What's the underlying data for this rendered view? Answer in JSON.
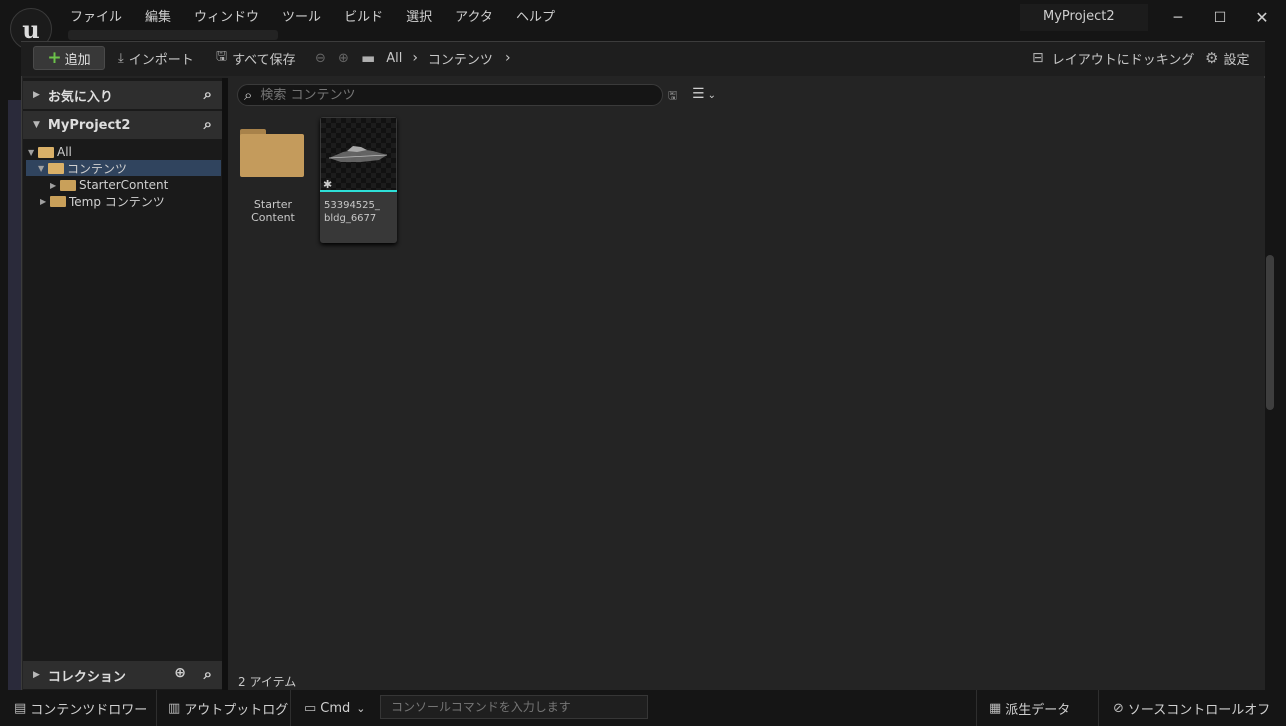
{
  "titlebar": {
    "logo": "ue-logo",
    "menu": [
      "ファイル",
      "編集",
      "ウィンドウ",
      "ツール",
      "ビルド",
      "選択",
      "アクタ",
      "ヘルプ"
    ],
    "project_tab": "MyProject2"
  },
  "toolbar": {
    "add_label": "追加",
    "import_label": "インポート",
    "save_all_label": "すべて保存",
    "breadcrumb": [
      "All",
      "コンテンツ"
    ],
    "dock_label": "レイアウトにドッキング",
    "settings_label": "設定"
  },
  "sidebar": {
    "favorites_label": "お気に入り",
    "project_label": "MyProject2",
    "tree": [
      {
        "label": "All",
        "level": 0,
        "expanded": true,
        "selected": false
      },
      {
        "label": "コンテンツ",
        "level": 1,
        "expanded": true,
        "selected": true
      },
      {
        "label": "StarterContent",
        "level": 2,
        "expanded": false,
        "selected": false
      },
      {
        "label": "Temp コンテンツ",
        "level": 1,
        "expanded": false,
        "selected": false
      }
    ],
    "collections_label": "コレクション"
  },
  "content": {
    "search_placeholder": "検索 コンテンツ",
    "items": [
      {
        "type": "folder",
        "label_line1": "Starter",
        "label_line2": "Content"
      },
      {
        "type": "asset",
        "label_line1": "53394525_",
        "label_line2": "bldg_6677"
      }
    ],
    "item_count": "2 アイテム"
  },
  "statusbar": {
    "content_drawer": "コンテンツドロワー",
    "output_log": "アウトプットログ",
    "cmd_label": "Cmd",
    "console_placeholder": "コンソールコマンドを入力します",
    "derived_data": "派生データ",
    "source_control": "ソースコントロールオフ"
  },
  "colors": {
    "accent_cyan": "#2ee0d8",
    "folder": "#c49b5c",
    "selection": "#30445e",
    "add_plus": "#6cc24a"
  }
}
